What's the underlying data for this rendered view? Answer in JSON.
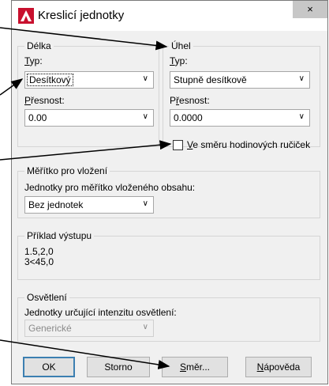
{
  "window": {
    "title": "Kreslicí jednotky",
    "close_glyph": "×",
    "app_icon": "autocad-icon"
  },
  "length": {
    "legend": "Délka",
    "type_label": "Typ:",
    "type_value": "Desítkový",
    "precision_label": "Přesnost:",
    "precision_value": "0.00"
  },
  "angle": {
    "legend": "Úhel",
    "type_label": "Typ:",
    "type_value": "Stupně desítkově",
    "precision_label": "Přesnost:",
    "precision_value": "0.0000",
    "clockwise_label": "Ve směru hodinových ručiček",
    "clockwise_checked": false
  },
  "insert_scale": {
    "legend": "Měřítko pro vložení",
    "label": "Jednotky pro měřítko vloženého obsahu:",
    "value": "Bez jednotek"
  },
  "sample": {
    "legend": "Příklad výstupu",
    "line1": "1.5,2,0",
    "line2": "3<45,0"
  },
  "lighting": {
    "legend": "Osvětlení",
    "label": "Jednotky určující intenzitu osvětlení:",
    "value": "Generické"
  },
  "buttons": {
    "ok": "OK",
    "cancel": "Storno",
    "direction": "Směr...",
    "help": "Nápověda"
  },
  "colors": {
    "arrow": "#000000",
    "default_button_border": "#3c7fb1"
  }
}
